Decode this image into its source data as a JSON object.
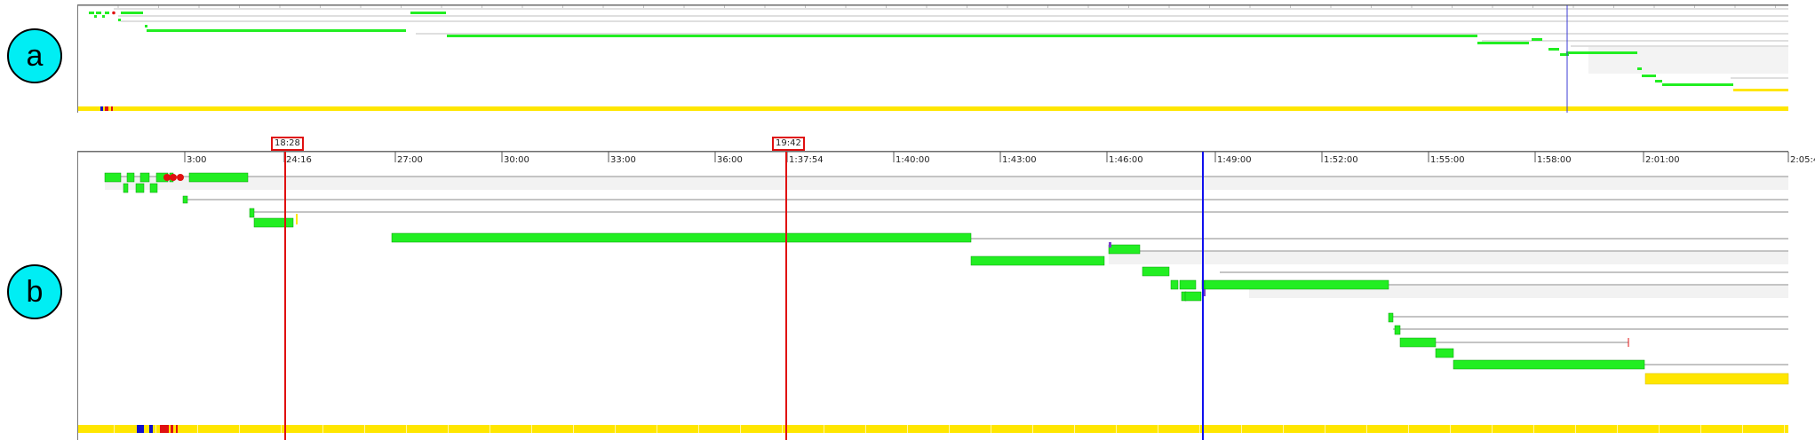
{
  "panels": {
    "a_label": "a",
    "b_label": "b"
  },
  "markers": {
    "m1": "18:28",
    "m2": "19:42"
  },
  "colors": {
    "bar": "#22ee22",
    "bar_edge": "#0a9a0a",
    "status": "#ffe600",
    "red_marker": "#e01010",
    "blue_marker": "#1010ee",
    "line": "#888888"
  },
  "ticks_b": [
    "3:00",
    "24:16",
    "27:00",
    "30:00",
    "33:00",
    "36:00",
    "1:37:54",
    "1:40:00",
    "1:43:00",
    "1:46:00",
    "1:49:00",
    "1:52:00",
    "1:55:00",
    "1:58:00",
    "2:01:00",
    "2:05:4"
  ]
}
